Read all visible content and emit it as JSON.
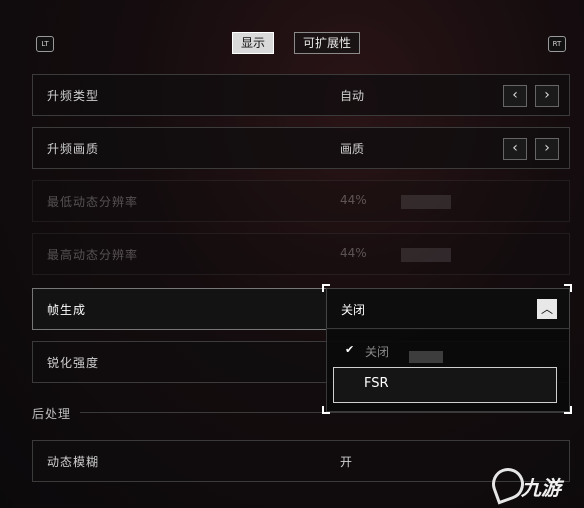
{
  "tabs": [
    "显示",
    "可扩展性"
  ],
  "shoulder": {
    "left": "LT",
    "right": "RT"
  },
  "rows": [
    {
      "label": "升频类型",
      "value": "自动"
    },
    {
      "label": "升频画质",
      "value": "画质"
    },
    {
      "label": "最低动态分辨率",
      "value": "44%"
    },
    {
      "label": "最高动态分辨率",
      "value": "44%"
    },
    {
      "label": "帧生成",
      "value": "关闭"
    },
    {
      "label": "锐化强度",
      "value": ""
    },
    {
      "label": "动态模糊",
      "value": "开"
    }
  ],
  "section": {
    "post_processing": "后处理"
  },
  "dropdown": {
    "current": "关闭",
    "options": [
      "关闭",
      "FSR"
    ],
    "check": "✔",
    "chevron": "︿"
  },
  "arrows": {
    "left": "‹",
    "right": "›"
  },
  "watermark": {
    "text": "九游"
  }
}
